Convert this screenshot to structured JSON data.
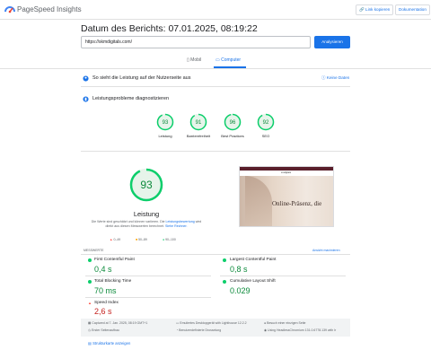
{
  "app": {
    "name": "PageSpeed Insights"
  },
  "header": {
    "copy_link": "Link kopieren",
    "docs": "Dokumentation"
  },
  "report": {
    "title": "Datum des Berichts: 07.01.2025, 08:19:22"
  },
  "search": {
    "url": "https://skmdigitals.com/",
    "button": "Analysieren"
  },
  "tabs": [
    {
      "label": "Mobil"
    },
    {
      "label": "Computer"
    }
  ],
  "crux": {
    "text": "So sieht die Leistung auf der Nutzerseite aus",
    "link": "Keine Daten"
  },
  "diag": {
    "text": "Leistungsprobleme diagnostizieren"
  },
  "scores": [
    {
      "label": "Leistung",
      "value": "93"
    },
    {
      "label": "Barrierefreiheit",
      "value": "91"
    },
    {
      "label": "Best Practices",
      "value": "96"
    },
    {
      "label": "SEO",
      "value": "92"
    }
  ],
  "perf": {
    "score": "93",
    "label": "Leistung",
    "note1": "Die Werte sind geschätzt und können variieren. Die",
    "note_link": "Leistungsbewertung",
    "note2": "wird direkt aus diesen Messwerten berechnet.",
    "note_link2": "Siehe Rechner.",
    "legend": [
      "0–49",
      "50–89",
      "90–100"
    ]
  },
  "preview": {
    "headline": "Online-Präsenz, die",
    "logo": "smdigitals"
  },
  "metrics_header": {
    "left": "MESSWERTE",
    "right": "Ansicht maximieren"
  },
  "metrics": [
    {
      "name": "First Contentful Paint",
      "value": "0,4 s",
      "status": "good"
    },
    {
      "name": "Largest Contentful Paint",
      "value": "0,8 s",
      "status": "good"
    },
    {
      "name": "Total Blocking Time",
      "value": "70 ms",
      "status": "good"
    },
    {
      "name": "Cumulative Layout Shift",
      "value": "0.029",
      "status": "good"
    },
    {
      "name": "Speed Index",
      "value": "2,6 s",
      "status": "bad"
    }
  ],
  "info": [
    "Captured at 7. Jan. 2025, 08:19 GMT+1",
    "Emuliertes Desktopgerät with Lighthouse 12.2.2",
    "Besuch einer einzigen Seite",
    "Erster Seitenaufbau",
    "Benutzerdefinierte Drosselung",
    "Using HeadlessChromium 131.0.6778.139 with lr"
  ],
  "treemap": "Strukturkarte anzeigen",
  "colors": {
    "good": "#0cce6b",
    "bad": "#ff4e42",
    "accent": "#1a73e8"
  }
}
